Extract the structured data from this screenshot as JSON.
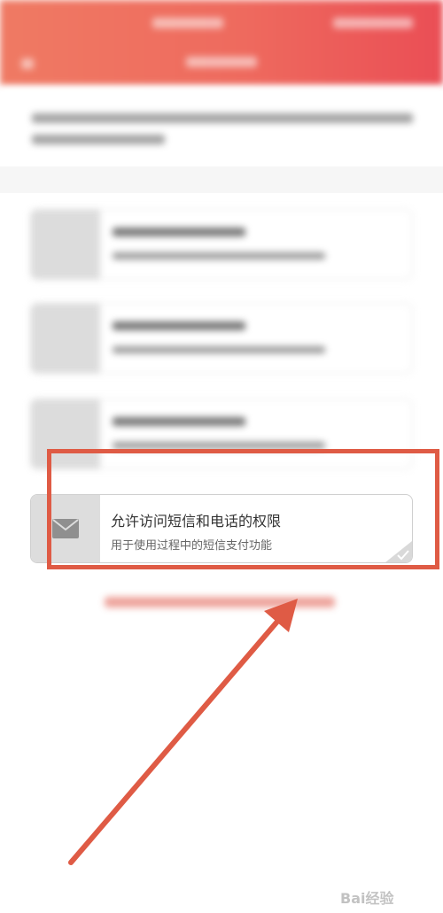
{
  "permission_highlighted": {
    "title": "允许访问短信和电话的权限",
    "subtitle": "用于使用过程中的短信支付功能",
    "icon": "envelope-icon",
    "checked": true
  },
  "colors": {
    "header_start": "#ef7a63",
    "header_end": "#ea4e55",
    "annotation": "#df5b45"
  },
  "watermark": {
    "text": "Bai经验"
  }
}
